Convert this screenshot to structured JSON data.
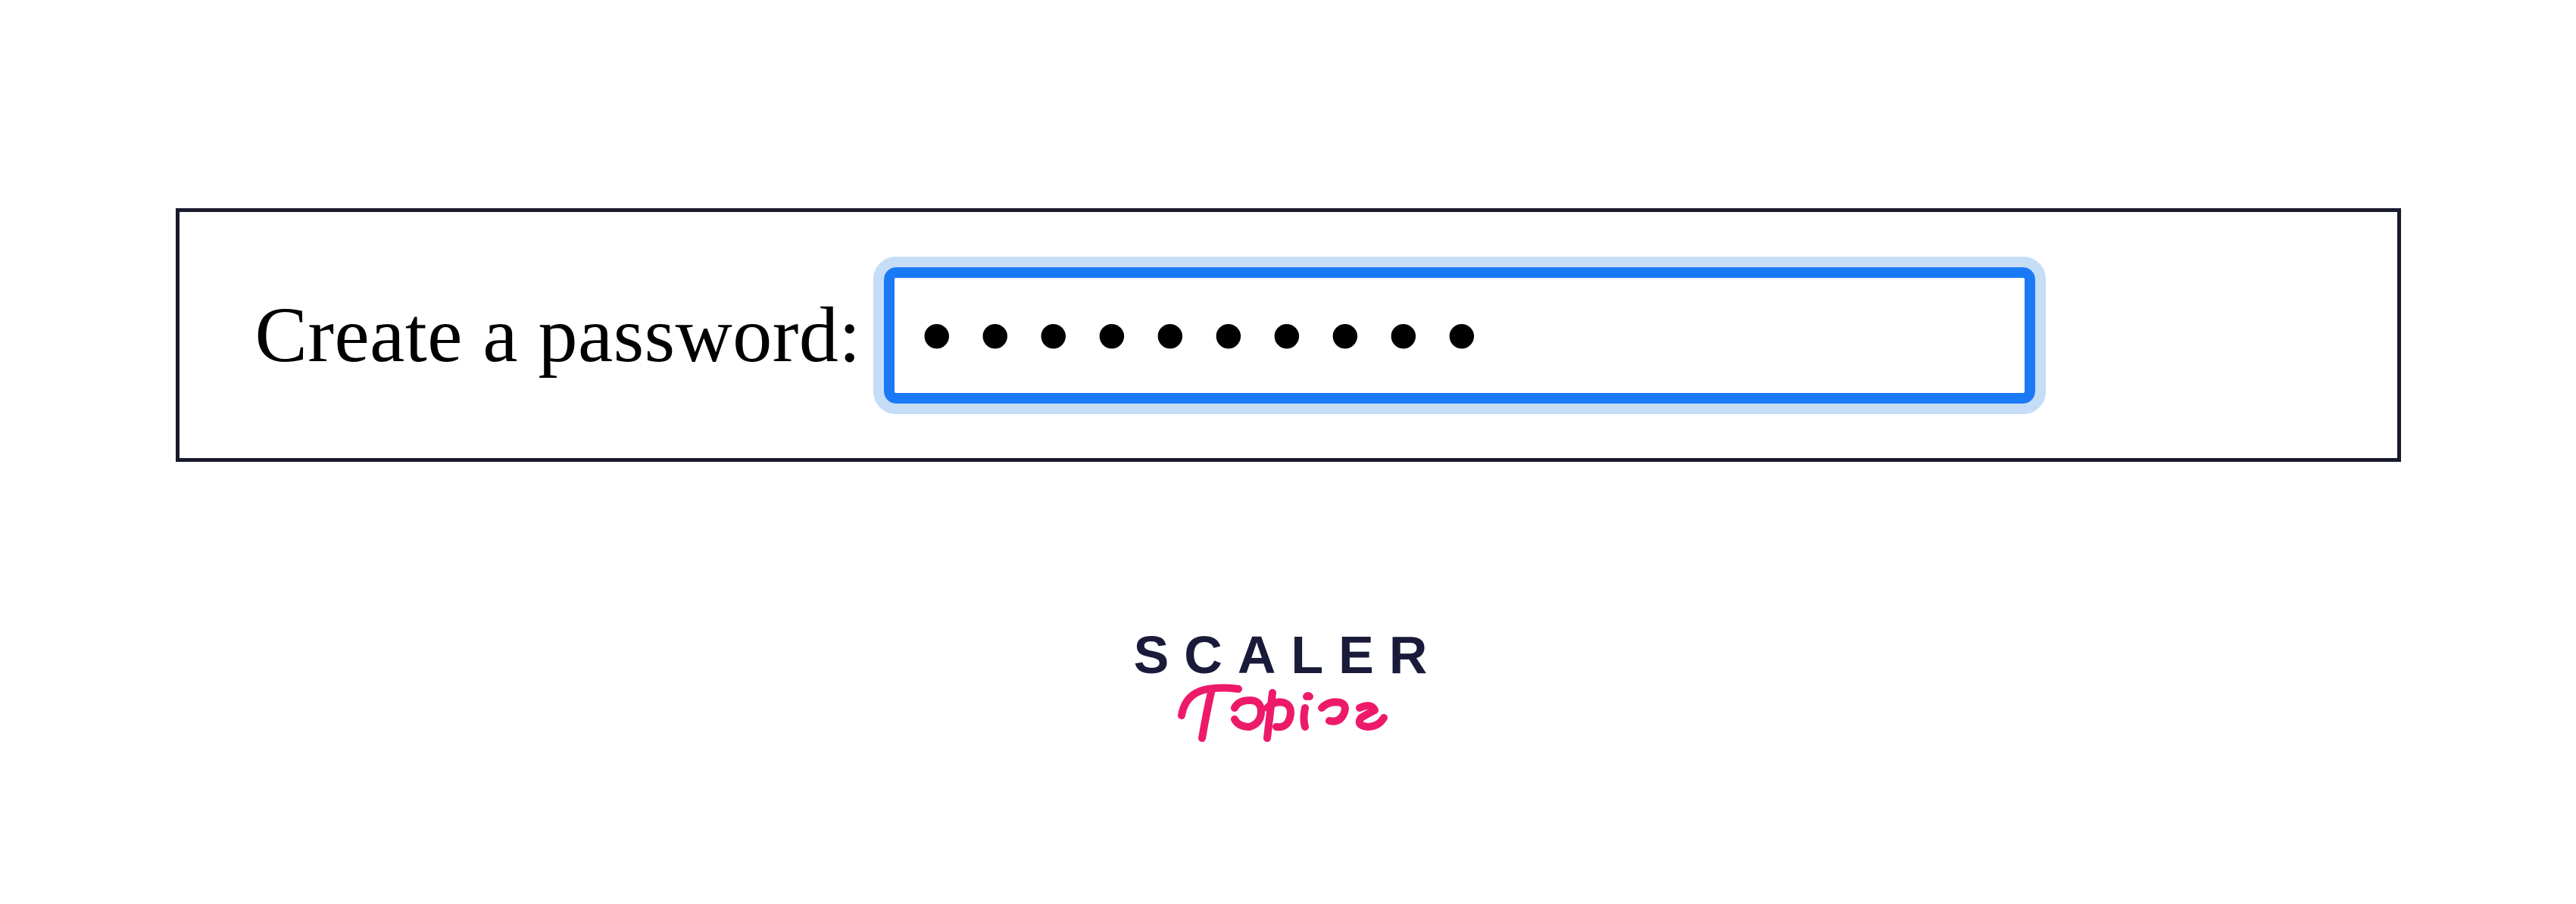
{
  "form": {
    "label": "Create a password:",
    "password_value": "••••••••••",
    "password_type": "password"
  },
  "branding": {
    "scaler_text": "SCALER",
    "topics_text": "Topics"
  },
  "colors": {
    "input_border": "#1a7af5",
    "input_outline": "#c5ddf7",
    "container_border": "#1a1a2e",
    "scaler_color": "#1a1a3a",
    "topics_color": "#ed1a6a"
  }
}
